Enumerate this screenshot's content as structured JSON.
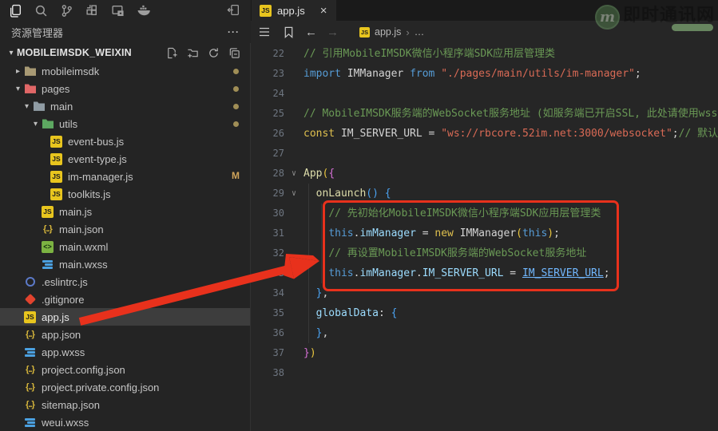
{
  "activity_bar": {
    "icons": [
      "explorer",
      "search",
      "source-control",
      "extensions",
      "remote-window",
      "docker",
      "panel-toggle"
    ],
    "active_icon": "explorer"
  },
  "sidebar": {
    "title": "资源管理器",
    "more_label": "···",
    "tree": {
      "root_label": "MOBILEIMSDK_WEIXIN",
      "root_chevron": "▾",
      "actions": [
        "new-file",
        "new-folder",
        "refresh-explorer",
        "collapse-folders"
      ],
      "items": [
        {
          "label": "mobileimsdk",
          "type": "folder",
          "color": "#a89a74",
          "level": 1,
          "expanded": false,
          "badge": "dot"
        },
        {
          "label": "pages",
          "type": "folder",
          "color": "#e06767",
          "level": 1,
          "expanded": true,
          "badge": "dot"
        },
        {
          "label": "main",
          "type": "folder",
          "color": "#909ca4",
          "level": 2,
          "expanded": true,
          "badge": "dot"
        },
        {
          "label": "utils",
          "type": "folder",
          "color": "#5da861",
          "level": 3,
          "expanded": true,
          "badge": "dot"
        },
        {
          "label": "event-bus.js",
          "type": "js",
          "level": 4
        },
        {
          "label": "event-type.js",
          "type": "js",
          "level": 4
        },
        {
          "label": "im-manager.js",
          "type": "js",
          "level": 4,
          "badge": "M"
        },
        {
          "label": "toolkits.js",
          "type": "js",
          "level": 4
        },
        {
          "label": "main.js",
          "type": "js",
          "level": 3
        },
        {
          "label": "main.json",
          "type": "json",
          "level": 3
        },
        {
          "label": "main.wxml",
          "type": "wxml",
          "level": 3
        },
        {
          "label": "main.wxss",
          "type": "wxss",
          "level": 3
        },
        {
          "label": ".eslintrc.js",
          "type": "eslint",
          "level": 1
        },
        {
          "label": ".gitignore",
          "type": "git",
          "level": 1
        },
        {
          "label": "app.js",
          "type": "js",
          "level": 1,
          "selected": true
        },
        {
          "label": "app.json",
          "type": "json",
          "level": 1
        },
        {
          "label": "app.wxss",
          "type": "wxss",
          "level": 1
        },
        {
          "label": "project.config.json",
          "type": "json",
          "level": 1
        },
        {
          "label": "project.private.config.json",
          "type": "json",
          "level": 1
        },
        {
          "label": "sitemap.json",
          "type": "json",
          "level": 1
        },
        {
          "label": "weui.wxss",
          "type": "wxss",
          "level": 1
        }
      ]
    }
  },
  "editor": {
    "tab": {
      "label": "app.js",
      "icon": "js",
      "close_label": "×"
    },
    "toolbar_icons": [
      "outline-list",
      "bookmark",
      "back-arrow",
      "forward-arrow"
    ],
    "back_arrow": "←",
    "forward_arrow": "→",
    "breadcrumb": {
      "file": "app.js",
      "separator": "›",
      "more": "…"
    },
    "lines": [
      {
        "n": 22,
        "tokens": [
          {
            "t": "// 引用MobileIMSDK微信小程序端SDK应用层管理类",
            "c": "cmt"
          }
        ]
      },
      {
        "n": 23,
        "tokens": [
          {
            "t": "import ",
            "c": "kw"
          },
          {
            "t": "IMManager ",
            "c": "pl"
          },
          {
            "t": "from ",
            "c": "kw"
          },
          {
            "t": "\"./pages/main/utils/im-manager\"",
            "c": "str"
          },
          {
            "t": ";",
            "c": "pl"
          }
        ]
      },
      {
        "n": 24,
        "tokens": []
      },
      {
        "n": 25,
        "tokens": [
          {
            "t": "// MobileIMSDK服务端的WebSocket服务地址 (如服务端已开启SSL, 此处请使用wss)",
            "c": "cmt"
          }
        ]
      },
      {
        "n": 26,
        "tokens": [
          {
            "t": "const ",
            "c": "kwy"
          },
          {
            "t": "IM_SERVER_URL ",
            "c": "pl"
          },
          {
            "t": "= ",
            "c": "pl"
          },
          {
            "t": "\"ws://rbcore.52im.net:3000/websocket\"",
            "c": "str"
          },
          {
            "t": ";",
            "c": "pl"
          },
          {
            "t": "// 默认",
            "c": "cmt"
          }
        ]
      },
      {
        "n": 27,
        "tokens": []
      },
      {
        "n": 28,
        "fold": true,
        "tokens": [
          {
            "t": "App",
            "c": "fn"
          },
          {
            "t": "(",
            "c": "b1"
          },
          {
            "t": "{",
            "c": "b2"
          }
        ]
      },
      {
        "n": 29,
        "fold": true,
        "g": [
          0
        ],
        "tokens": [
          {
            "t": "  ",
            "c": "pl"
          },
          {
            "t": "onLaunch",
            "c": "fn"
          },
          {
            "t": "()",
            "c": "b3"
          },
          {
            "t": " ",
            "c": "pl"
          },
          {
            "t": "{",
            "c": "b3"
          }
        ]
      },
      {
        "n": 30,
        "g": [
          0,
          1
        ],
        "tokens": [
          {
            "t": "    ",
            "c": "pl"
          },
          {
            "t": "// 先初始化MobileIMSDK微信小程序端SDK应用层管理类",
            "c": "cmt"
          }
        ]
      },
      {
        "n": 31,
        "g": [
          0,
          1
        ],
        "tokens": [
          {
            "t": "    ",
            "c": "pl"
          },
          {
            "t": "this",
            "c": "kw"
          },
          {
            "t": ".",
            "c": "pl"
          },
          {
            "t": "imManager",
            "c": "prop"
          },
          {
            "t": " = ",
            "c": "pl"
          },
          {
            "t": "new",
            "c": "kwy"
          },
          {
            "t": " IMManager",
            "c": "pl"
          },
          {
            "t": "(",
            "c": "b1"
          },
          {
            "t": "this",
            "c": "kw"
          },
          {
            "t": ")",
            "c": "b1"
          },
          {
            "t": ";",
            "c": "pl"
          }
        ]
      },
      {
        "n": 32,
        "g": [
          0,
          1
        ],
        "tokens": [
          {
            "t": "    ",
            "c": "pl"
          },
          {
            "t": "// 再设置MobileIMSDK服务端的WebSocket服务地址",
            "c": "cmt"
          }
        ]
      },
      {
        "n": 33,
        "g": [
          0,
          1
        ],
        "tokens": [
          {
            "t": "    ",
            "c": "pl"
          },
          {
            "t": "this",
            "c": "kw"
          },
          {
            "t": ".",
            "c": "pl"
          },
          {
            "t": "imManager",
            "c": "prop"
          },
          {
            "t": ".",
            "c": "pl"
          },
          {
            "t": "IM_SERVER_URL",
            "c": "prop"
          },
          {
            "t": " = ",
            "c": "pl"
          },
          {
            "t": "IM_SERVER_URL",
            "c": "link"
          },
          {
            "t": ";",
            "c": "pl"
          }
        ]
      },
      {
        "n": 34,
        "g": [
          0
        ],
        "tokens": [
          {
            "t": "  ",
            "c": "pl"
          },
          {
            "t": "}",
            "c": "b3"
          },
          {
            "t": ",",
            "c": "pl"
          }
        ]
      },
      {
        "n": 35,
        "g": [
          0
        ],
        "tokens": [
          {
            "t": "  ",
            "c": "pl"
          },
          {
            "t": "globalData",
            "c": "prop"
          },
          {
            "t": ": ",
            "c": "pl"
          },
          {
            "t": "{",
            "c": "b3"
          }
        ]
      },
      {
        "n": 36,
        "g": [
          0
        ],
        "tokens": [
          {
            "t": "  ",
            "c": "pl"
          },
          {
            "t": "}",
            "c": "b3"
          },
          {
            "t": ",",
            "c": "pl"
          }
        ]
      },
      {
        "n": 37,
        "tokens": [
          {
            "t": "}",
            "c": "b2"
          },
          {
            "t": ")",
            "c": "b1"
          }
        ]
      },
      {
        "n": 38,
        "tokens": []
      }
    ]
  },
  "annotations": {
    "highlight_box_color": "#e8311c",
    "arrow_color": "#e8311c",
    "arrow_points_from": "app.js tree item",
    "arrow_points_to": "highlighted code lines 30-33"
  },
  "watermark": {
    "logo_letter": "m",
    "title": "即时通讯网"
  }
}
